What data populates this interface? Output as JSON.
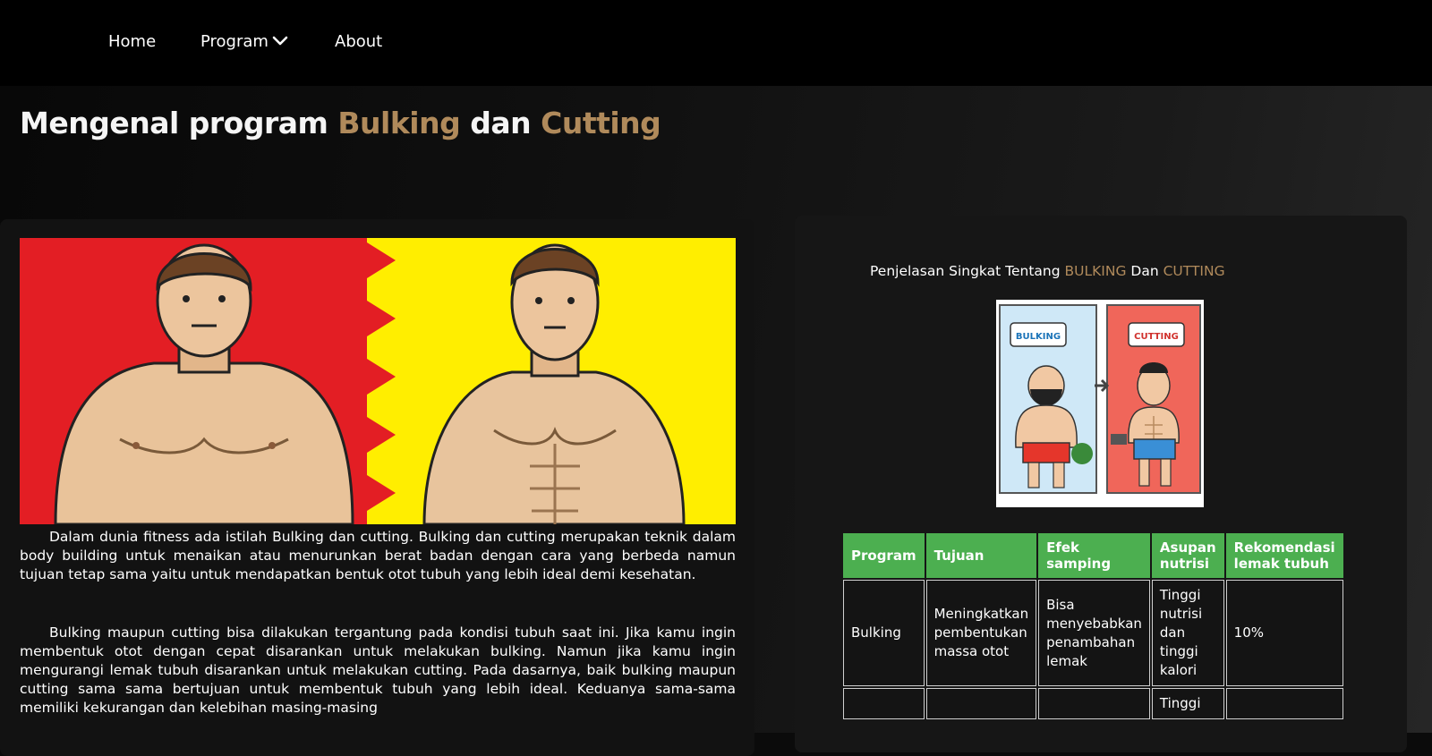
{
  "nav": {
    "home": "Home",
    "program": "Program",
    "about": "About"
  },
  "page_title": {
    "prefix": "Mengenal program ",
    "bulking": "Bulking",
    "middle": " dan ",
    "cutting": "Cutting"
  },
  "left": {
    "paragraph1": "Dalam dunia fitness ada istilah Bulking dan cutting. Bulking dan cutting merupakan teknik dalam body building untuk menaikan atau menurunkan berat badan dengan cara yang berbeda namun tujuan tetap sama yaitu untuk mendapatkan bentuk otot tubuh yang lebih ideal demi kesehatan.",
    "paragraph2": "Bulking maupun cutting bisa dilakukan tergantung pada kondisi tubuh saat ini. Jika kamu ingin membentuk otot dengan cepat disarankan untuk melakukan bulking. Namun jika kamu ingin mengurangi lemak tubuh disarankan untuk melakukan cutting. Pada dasarnya, baik bulking maupun cutting sama sama bertujuan untuk membentuk tubuh yang lebih ideal. Keduanya sama-sama memiliki kekurangan dan kelebihan masing-masing"
  },
  "right": {
    "heading_prefix": "Penjelasan Singkat Tentang ",
    "heading_bulking": "BULKING",
    "heading_middle": " Dan ",
    "heading_cutting": "CUTTING",
    "image_label_bulking": "BULKING",
    "image_label_cutting": "CUTTING"
  },
  "table": {
    "headers": [
      "Program",
      "Tujuan",
      "Efek samping",
      "Asupan nutrisi",
      "Rekomendasi lemak tubuh"
    ],
    "rows": [
      [
        "Bulking",
        "Meningkatkan pembentukan massa otot",
        "Bisa menyebabkan penambahan lemak",
        "Tinggi nutrisi dan tinggi kalori",
        "10%"
      ],
      [
        "",
        "",
        "",
        "Tinggi",
        ""
      ]
    ]
  },
  "colors": {
    "accent": "#b08a5b",
    "table_header": "#4caf50",
    "nav_bg": "#000000"
  }
}
